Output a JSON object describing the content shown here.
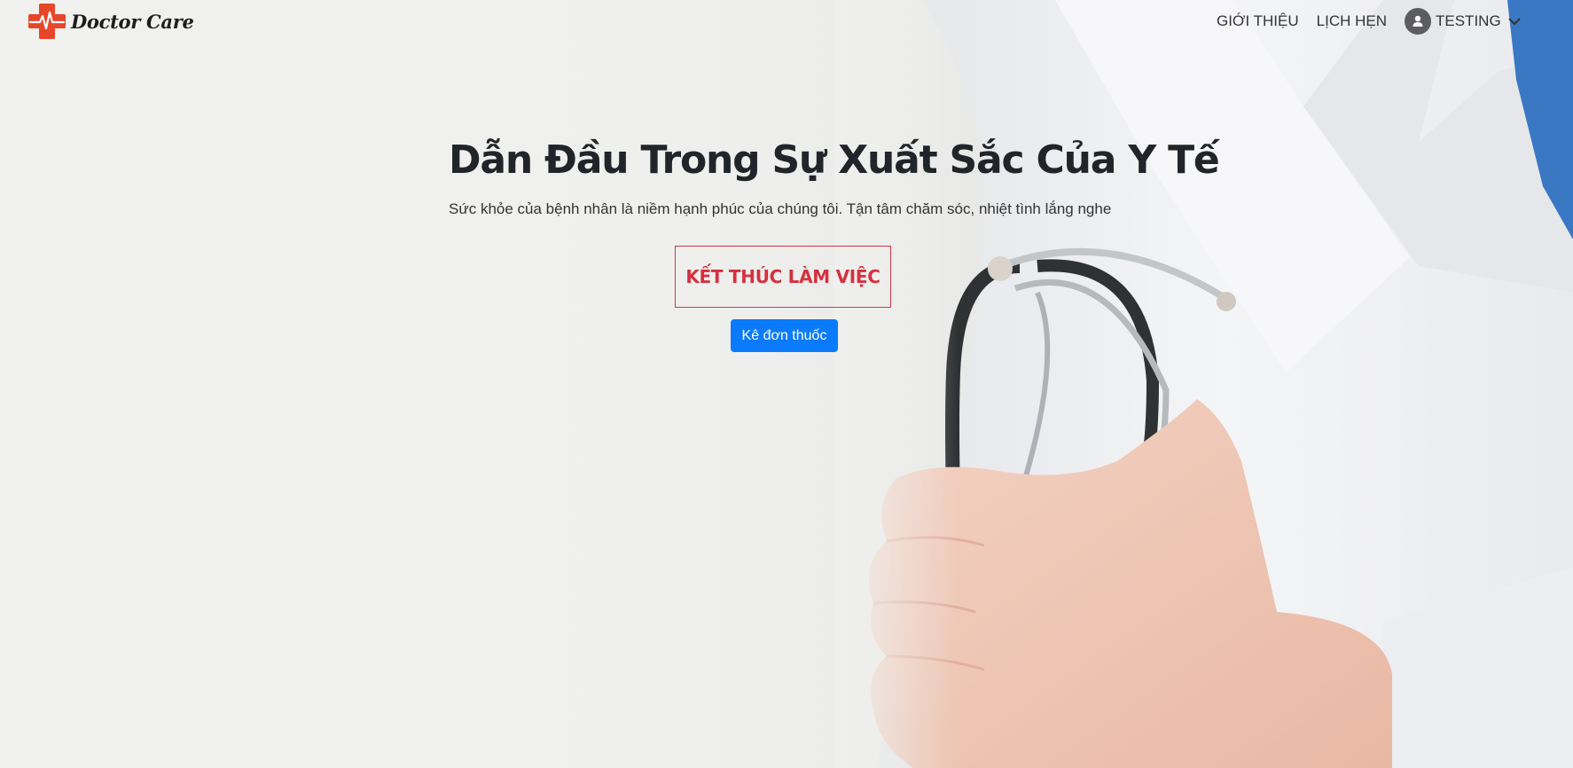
{
  "brand": {
    "name": "Doctor Care",
    "color": "#e8462b"
  },
  "nav": {
    "items": [
      {
        "label": "GIỚI THIỆU"
      },
      {
        "label": "LỊCH HẸN"
      }
    ],
    "user": {
      "name": "TESTING",
      "icon": "user-icon",
      "dropdown_icon": "chevron-down-icon"
    }
  },
  "hero": {
    "title": "Dẫn Đầu Trong Sự Xuất Sắc Của Y Tế",
    "subtitle": "Sức khỏe của bệnh nhân là niềm hạnh phúc của chúng tôi. Tận tâm chăm sóc, nhiệt tình lắng nghe",
    "end_work_label": "KẾT THÚC LÀM VIỆC",
    "prescribe_label": "Kê đơn thuốc"
  },
  "colors": {
    "danger": "#d6303f",
    "primary": "#0a7bff"
  }
}
